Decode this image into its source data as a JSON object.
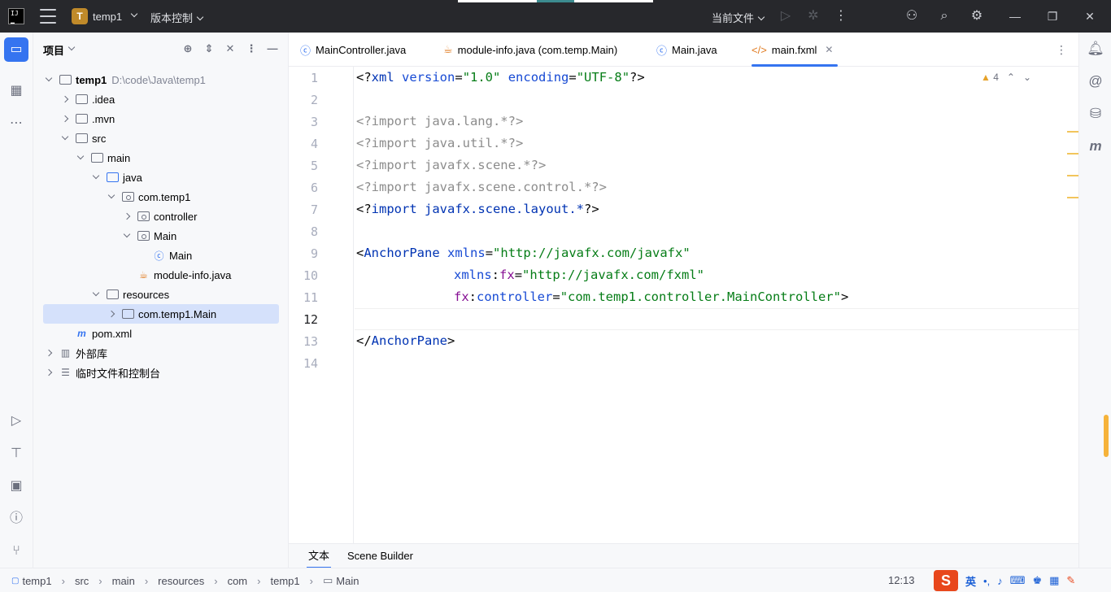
{
  "titlebar": {
    "project_initial": "T",
    "project_name": "temp1",
    "vcs_label": "版本控制",
    "run_config": "当前文件"
  },
  "project_panel": {
    "title": "项目",
    "tree": [
      {
        "label": "temp1",
        "path": "D:\\code\\Java\\temp1"
      },
      {
        "label": ".idea"
      },
      {
        "label": ".mvn"
      },
      {
        "label": "src"
      },
      {
        "label": "main"
      },
      {
        "label": "java"
      },
      {
        "label": "com.temp1"
      },
      {
        "label": "controller"
      },
      {
        "label": "Main"
      },
      {
        "label": "Main"
      },
      {
        "label": "module-info.java"
      },
      {
        "label": "resources"
      },
      {
        "label": "com.temp1.Main"
      },
      {
        "label": "pom.xml"
      },
      {
        "label": "外部库"
      },
      {
        "label": "临时文件和控制台"
      }
    ]
  },
  "tabs": [
    {
      "label": "MainController.java"
    },
    {
      "label": "module-info.java (com.temp.Main)"
    },
    {
      "label": "Main.java"
    },
    {
      "label": "main.fxml"
    }
  ],
  "editor": {
    "warning_count": "4",
    "line_numbers": [
      "1",
      "2",
      "3",
      "4",
      "5",
      "6",
      "7",
      "8",
      "9",
      "10",
      "11",
      "12",
      "13",
      "14"
    ],
    "lines": {
      "l1": {
        "open": "<?",
        "name": "xml",
        "a1": "version",
        "eq1": "=",
        "v1": "\"1.0\"",
        "a2": "encoding",
        "eq2": "=",
        "v2": "\"UTF-8\"",
        "close": "?>"
      },
      "l3": "<?import java.lang.*?>",
      "l4": "<?import java.util.*?>",
      "l5": "<?import javafx.scene.*?>",
      "l6": "<?import javafx.scene.control.*?>",
      "l7": {
        "open": "<?",
        "kw": "import",
        "pkg": "javafx.scene.layout.*",
        "close": "?>"
      },
      "l9": {
        "lt": "<",
        "tag": "AnchorPane",
        "attr": "xmlns",
        "eq": "=",
        "val": "\"http://javafx.com/javafx\""
      },
      "l10": {
        "ns": "xmlns",
        "colon": ":",
        "attr": "fx",
        "eq": "=",
        "val": "\"http://javafx.com/fxml\""
      },
      "l11": {
        "ns": "fx",
        "colon": ":",
        "attr": "controller",
        "eq": "=",
        "val": "\"com.temp1.controller.MainController\"",
        "gt": ">"
      },
      "l13": {
        "lt": "</",
        "tag": "AnchorPane",
        "gt": ">"
      }
    }
  },
  "bottom_tabs": [
    {
      "label": "文本"
    },
    {
      "label": "Scene Builder"
    }
  ],
  "statusbar": {
    "breadcrumb": [
      "temp1",
      "src",
      "main",
      "resources",
      "com",
      "temp1",
      "Main"
    ],
    "position": "12:13",
    "ime_logo": "S",
    "ime_lang": "英"
  }
}
